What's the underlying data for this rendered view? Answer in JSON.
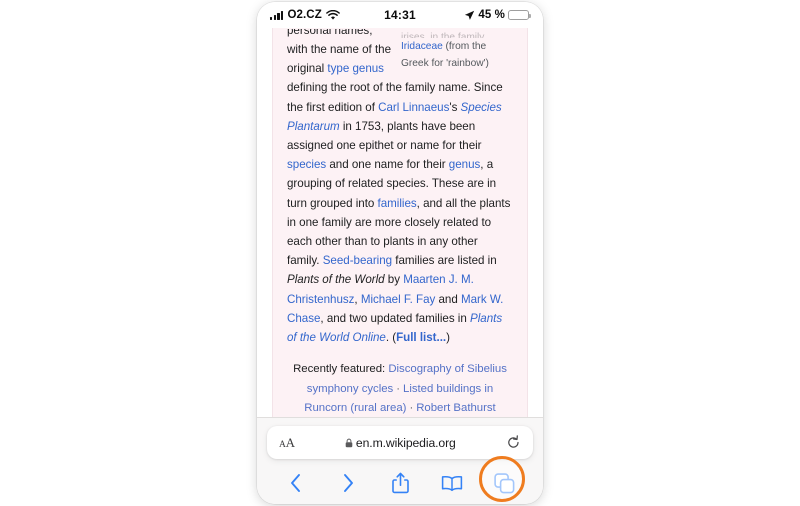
{
  "status_bar": {
    "carrier": "O2.CZ",
    "time": "14:31",
    "battery_percent": "45 %",
    "wifi_icon": "wifi-icon",
    "signal_icon": "cellular-signal-icon",
    "location_icon": "location-arrow-icon",
    "battery_icon": "battery-icon",
    "battery_level": 45
  },
  "page": {
    "cut_off_line": "personal names,",
    "caption": {
      "cut_line": "irises, in the family",
      "link": "Iridaceae",
      "text": " (from the Greek for 'rainbow')"
    },
    "paragraph": {
      "p1": "with the name of the original ",
      "link_type": "type genus",
      "p2": " defining the root of the family name. Since the first edition of ",
      "link_linnaeus": "Carl Linnaeus",
      "p3": "'s ",
      "italic_species_plantarum": "Species Plantarum",
      "p4": " in 1753, plants have been assigned one epithet or name for their ",
      "link_species": "species",
      "p5": " and one name for their ",
      "link_genus": "genus",
      "p6": ", a grouping of related species. These are in turn grouped into ",
      "link_families": "families",
      "p7": ", and all the plants in one family are more closely related to each other than to plants in any other family. ",
      "link_seed_bearing": "Seed-bearing",
      "p8": " families are listed in ",
      "italic_plants_world": "Plants of the World",
      "p9": " by ",
      "link_maarten": "Maarten J. M. Christenhusz",
      "p10": ", ",
      "link_michael": "Michael F. Fay",
      "p11": " and ",
      "link_mark": "Mark W. Chase",
      "p12": ", and two updated families in ",
      "italic_plants_world_online": "Plants of the World Online",
      "p13": ". (",
      "link_full_list": "Full list...",
      "p14": ")"
    },
    "recently_featured": {
      "label": "Recently featured:",
      "items": [
        "Discography of Sibelius symphony cycles",
        "Listed buildings in Runcorn (rural area)",
        "Robert Bathurst filmography"
      ],
      "separator": "·"
    }
  },
  "browser": {
    "address_bar": {
      "text_size_label": "AA",
      "text_size_icon": "text-size-icon",
      "lock_icon": "lock-icon",
      "url": "en.m.wikipedia.org",
      "reload_icon": "reload-icon"
    },
    "toolbar": {
      "back_icon": "chevron-left-icon",
      "forward_icon": "chevron-right-icon",
      "share_icon": "share-icon",
      "bookmarks_icon": "book-icon",
      "tabs_icon": "tabs-icon"
    }
  },
  "annotation": {
    "highlight_target": "tabs-button",
    "highlight_color": "#ef7c1f"
  }
}
